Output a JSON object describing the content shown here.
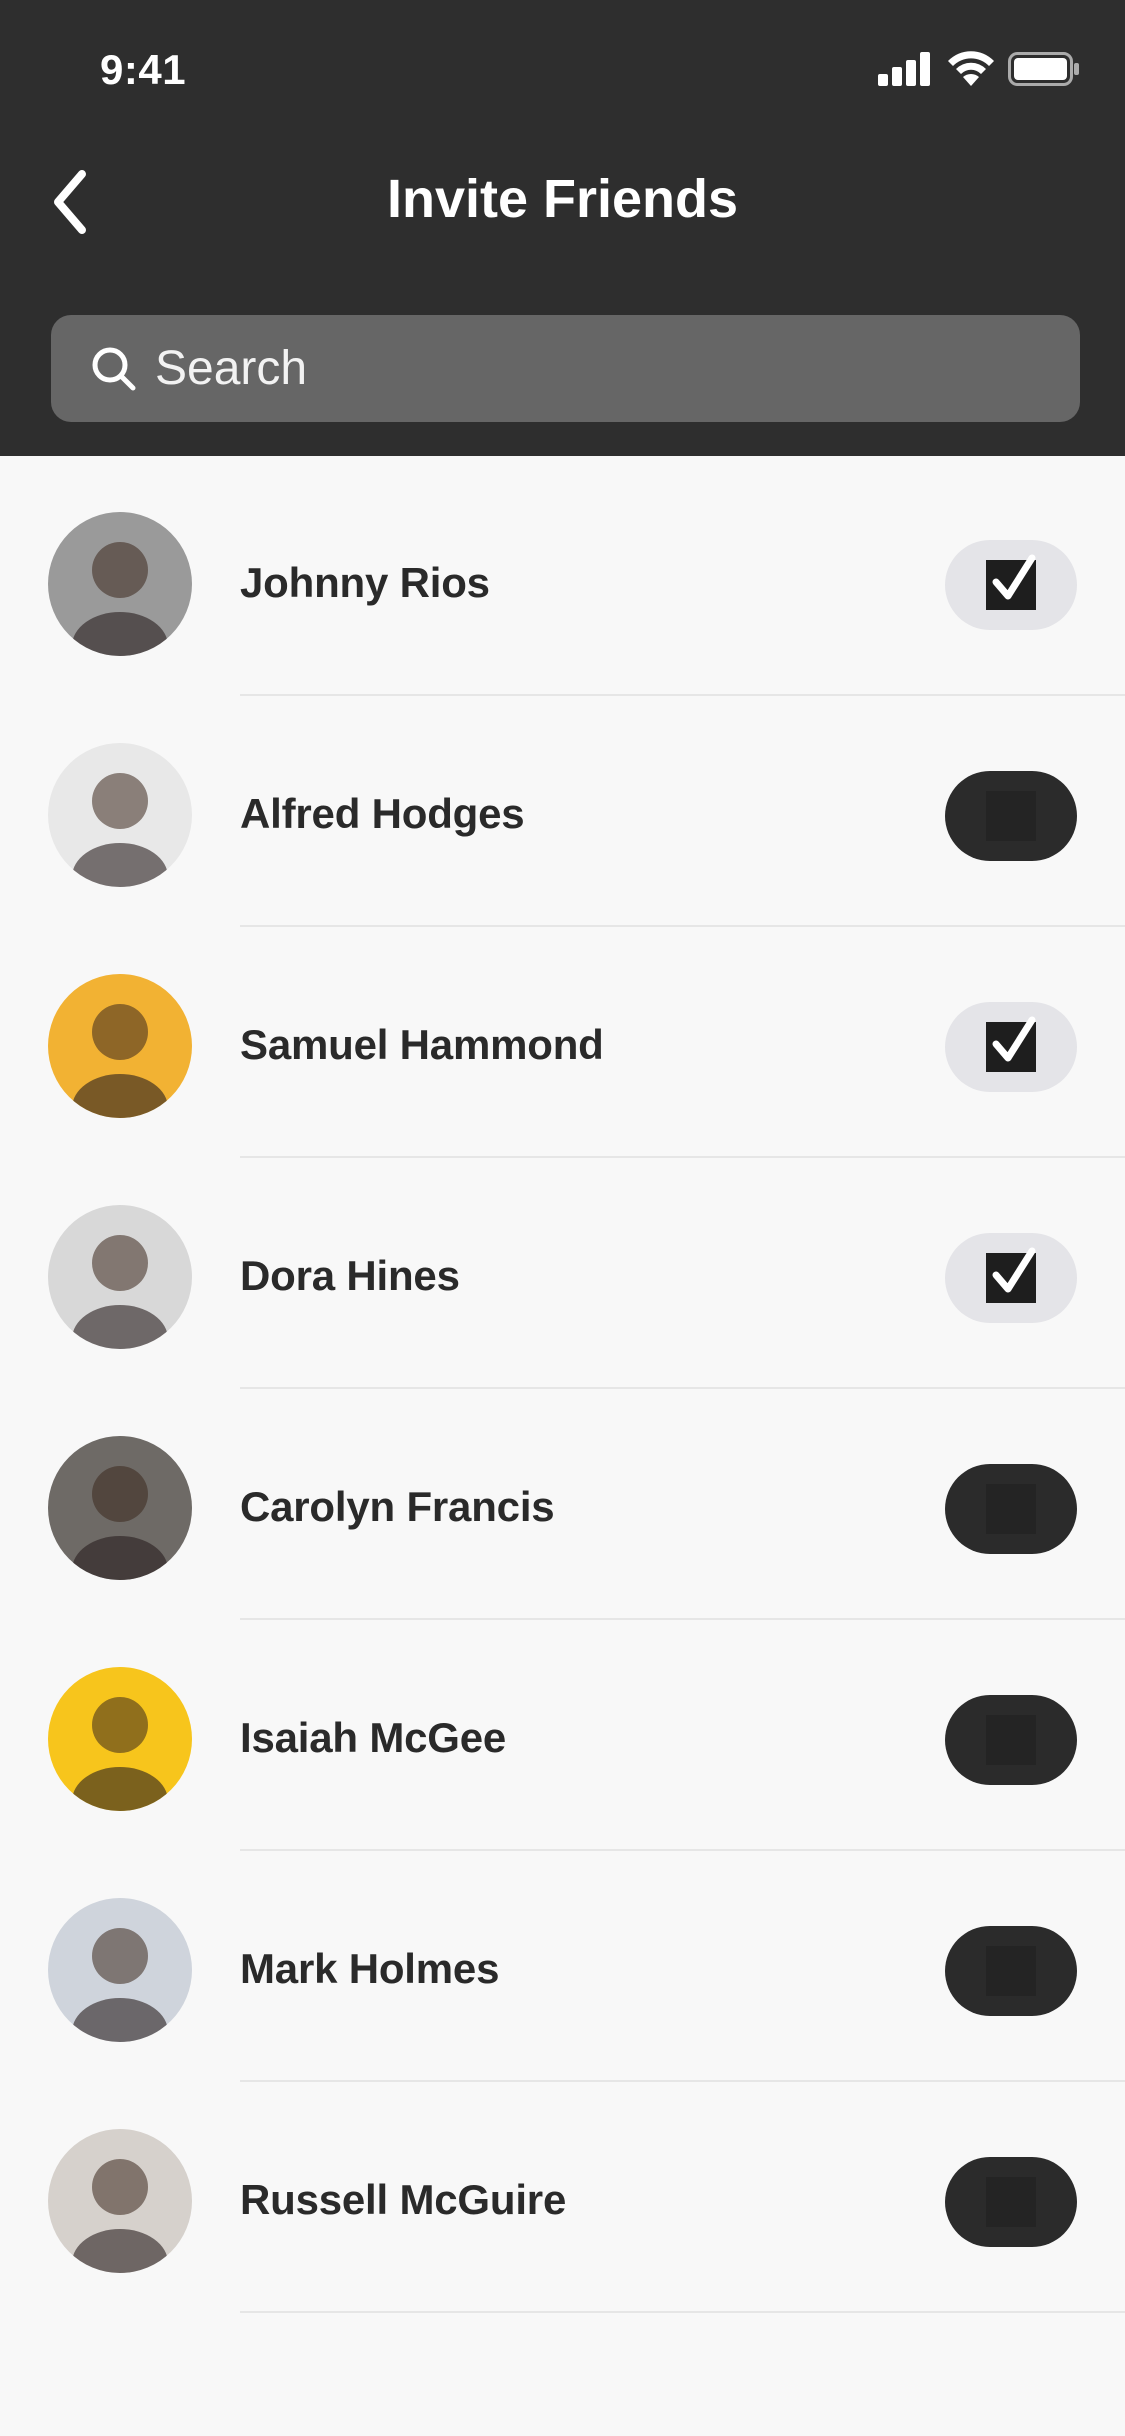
{
  "status_bar": {
    "time": "9:41"
  },
  "header": {
    "title": "Invite Friends",
    "back_icon": "chevron-left-icon"
  },
  "search": {
    "placeholder": "Search",
    "icon": "search-icon"
  },
  "friends": [
    {
      "name": "Johnny Rios",
      "selected": true,
      "avatar_color": "#9a9a9a"
    },
    {
      "name": "Alfred Hodges",
      "selected": false,
      "avatar_color": "#e8e8e8"
    },
    {
      "name": "Samuel Hammond",
      "selected": true,
      "avatar_color": "#f2b233"
    },
    {
      "name": "Dora Hines",
      "selected": true,
      "avatar_color": "#d8d8d8"
    },
    {
      "name": "Carolyn Francis",
      "selected": false,
      "avatar_color": "#6e6a66"
    },
    {
      "name": "Isaiah McGee",
      "selected": false,
      "avatar_color": "#f7c51c"
    },
    {
      "name": "Mark Holmes",
      "selected": false,
      "avatar_color": "#cfd4dc"
    },
    {
      "name": "Russell McGuire",
      "selected": false,
      "avatar_color": "#d6d1cc"
    }
  ],
  "colors": {
    "header_bg": "#2e2e2e",
    "search_bg": "#666666",
    "list_bg": "#f8f8f8",
    "toggle_on_bg": "#e4e4e8",
    "toggle_off_bg": "#2b2b2b"
  }
}
